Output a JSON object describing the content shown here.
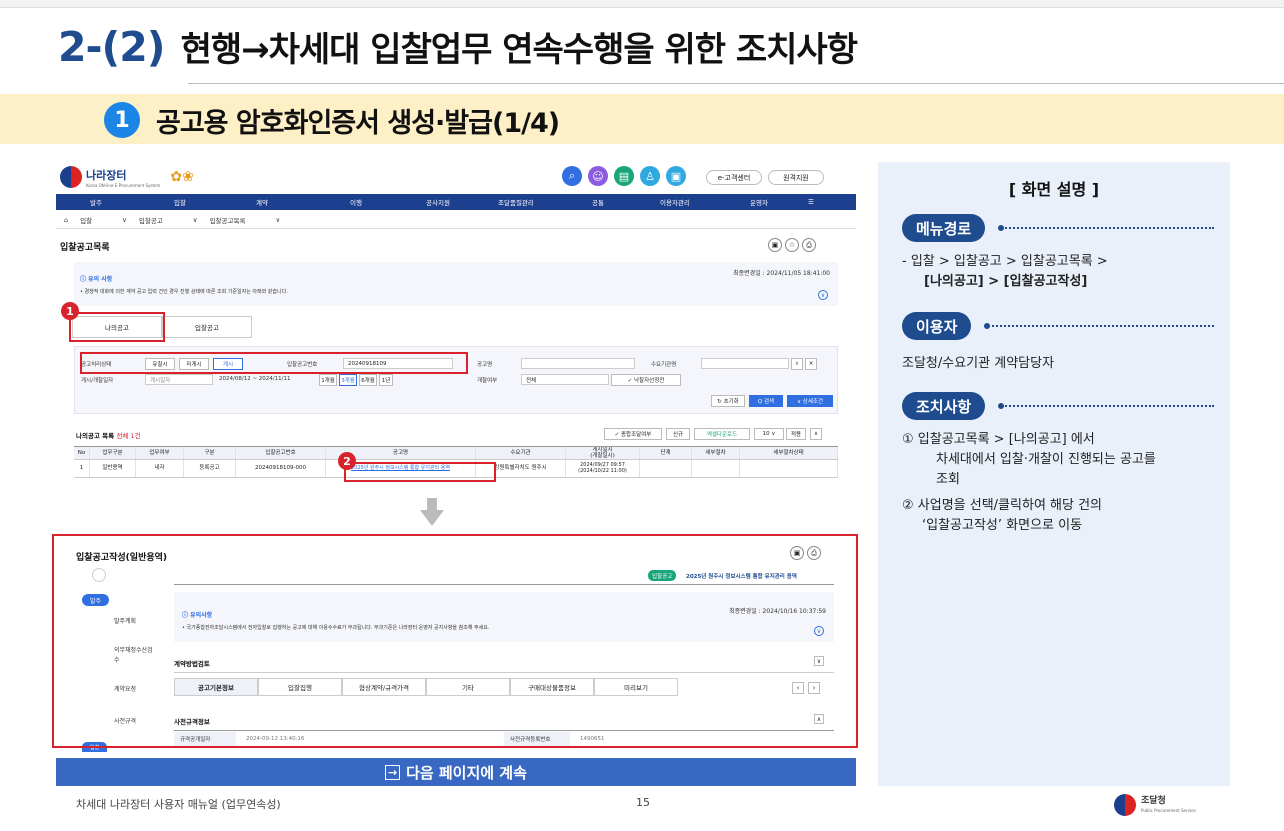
{
  "header": {
    "section_num": "2-(2)",
    "section_title": "현행→차세대 입찰업무 연속수행을 위한 조치사항",
    "sub_num": "1",
    "sub_title": "공고용 암호화인증서 생성·발급(1/4)"
  },
  "shot": {
    "logo": "나라장터",
    "logo_sub": "Korea ON-line E-Procurement System",
    "hdr_buttons": [
      "e-고객센터",
      "원격지원"
    ],
    "nav": [
      "발주",
      "입찰",
      "계약",
      "이행",
      "공사지원",
      "조달품질관리",
      "공통",
      "이용자관리",
      "운영자",
      "☰"
    ],
    "crumbs": [
      "입찰",
      "입찰공고",
      "입찰공고목록"
    ],
    "list_title": "입찰공고목록",
    "updated1": "최종변경일 : 2024/11/05 18:41:00",
    "notice_title": "유의 사항",
    "notice_text": "• 경쟁적 대화에 의한 계약 공고 입력 건인 경우 진행 상태에 따른 조회 기준일자는 아래와 같습니다.",
    "tabs": [
      "나의공고",
      "입찰공고"
    ],
    "search": {
      "l1": "공고처리상태",
      "s1": [
        "유찰시",
        "미게시",
        "게시"
      ],
      "l2": "입찰공고번호",
      "v2": "20240918109",
      "l3": "공고명",
      "l4": "수요기관명",
      "r1": "게시/개찰일자",
      "r1v": "게시일자",
      "r1d": "2024/08/12 ~ 2024/11/11",
      "periods": [
        "1개월",
        "3개월",
        "6개월",
        "1년"
      ],
      "l5": "개찰여부",
      "v5": "전체",
      "chk": "✓ 낙찰자선정전",
      "btns": [
        "↻ 초기화",
        "Q 검색",
        "∨ 상세조건"
      ]
    },
    "my_list": "나의공고 목록",
    "my_count": "전체 1건",
    "tools": [
      "✓ 종합조달여부",
      "신규",
      "엑셀다운로드",
      "10 ∨",
      "적용"
    ],
    "cols": [
      "No",
      "업무구분",
      "업무여부",
      "구분",
      "입찰공고번호",
      "공고명",
      "수요기관",
      "게시일시\n(개찰일시)",
      "단계",
      "세부절차",
      "세부절차상태"
    ],
    "row": [
      "1",
      "일반용역",
      "내자",
      "등록공고",
      "20240918109-000",
      "2025년 원주시 정보시스템 통합 유지관리 용역",
      "강원특별자치도 원주시",
      "2024/09/27 09:57\n(2024/10/22 11:00)",
      "",
      "",
      ""
    ],
    "lower_title": "입찰공고작성(일반용역)",
    "badge": "입찰공고",
    "project": "2025년 원주시 정보시스템 통합 유지관리 용역",
    "updated2": "최종변경일 : 2024/10/16 10:37:59",
    "notice2_title": "유의사항",
    "notice2_text": "• 국가종합전자조달시스템에서 전자입찰로 집행하는 공고에 대해 이용수수료가 부과됩니다. 부과기준은 나라장터 운영자 공지사항을 참조해 주세요.",
    "steps_tag": "발주",
    "steps": [
      "발주계획",
      "의무채정수산검수",
      "계약요청",
      "사전규격"
    ],
    "method": "계약방법검토",
    "lower_tabs": [
      "공고기본정보",
      "입찰집행",
      "협상계약/규격가격",
      "기타",
      "구매대상물품정보",
      "미리보기"
    ],
    "spec": "사전규격정보",
    "spec_l1": "규격공개일자",
    "spec_v1": "2024-09-12 13:40:16",
    "spec_l2": "사전규격등록번호",
    "spec_v2": "1490651",
    "badge_bottom": "입찰",
    "marker1": "1",
    "marker2": "2"
  },
  "continue_bar": "다음 페이지에 계속",
  "footer": {
    "left": "차세대 나라장터 사용자 매뉴얼 (업무연속성)",
    "page": "15",
    "logo": "조달청",
    "logo_sub": "Public Procurement Service"
  },
  "panel": {
    "title": "[ 화면 설명 ]",
    "menu_label": "메뉴경로",
    "menu_path_1": "-  입찰 > 입찰공고 > 입찰공고목록 >",
    "menu_path_2": "[나의공고] > [입찰공고작성]",
    "user_label": "이용자",
    "user_text": "조달청/수요기관 계약담당자",
    "action_label": "조치사항",
    "action_1a": "① 입찰공고목록 > [나의공고] 에서",
    "action_1b": "차세대에서 입찰·개찰이 진행되는 공고를",
    "action_1c": "조회",
    "action_2a": "② 사업명을 선택/클릭하여 해당 건의",
    "action_2b": "‘입찰공고작성’ 화면으로 이동"
  },
  "colors": {
    "navy": "#1e4c8f",
    "highlight_red": "#d8222c",
    "band": "#fdefc6",
    "panel_bg": "#e9f0f9",
    "bar_blue": "#3868c2"
  }
}
